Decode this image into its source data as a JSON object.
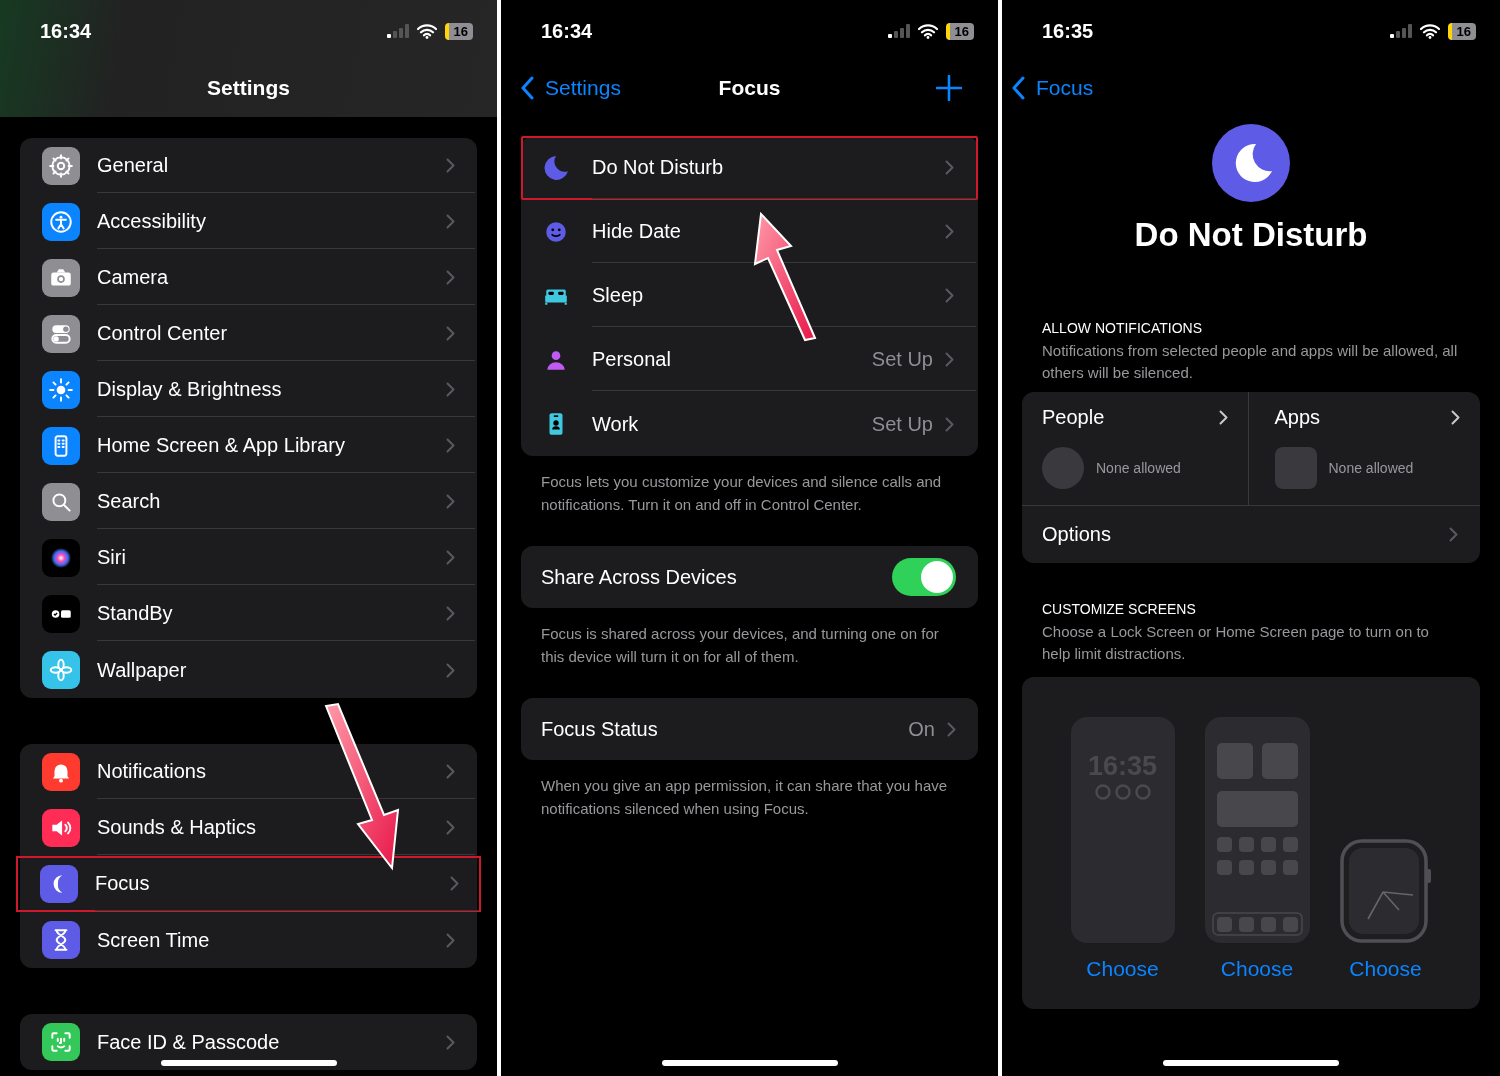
{
  "settings_screen": {
    "status_bar": {
      "time": "16:34",
      "battery": "16"
    },
    "title": "Settings",
    "groups": [
      {
        "items": [
          {
            "label": "General",
            "color": "#8e8e93",
            "highlighted": false
          },
          {
            "label": "Accessibility",
            "color": "#0a84ff",
            "highlighted": false
          },
          {
            "label": "Camera",
            "color": "#8e8e93",
            "highlighted": false
          },
          {
            "label": "Control Center",
            "color": "#8e8e93",
            "highlighted": false
          },
          {
            "label": "Display & Brightness",
            "color": "#0a84ff",
            "highlighted": false
          },
          {
            "label": "Home Screen & App Library",
            "color": "#0a84ff",
            "highlighted": false
          },
          {
            "label": "Search",
            "color": "#8e8e93",
            "highlighted": false
          },
          {
            "label": "Siri",
            "color": "#000000",
            "highlighted": false
          },
          {
            "label": "StandBy",
            "color": "#000000",
            "highlighted": false
          },
          {
            "label": "Wallpaper",
            "color": "#35c3ea",
            "highlighted": false
          }
        ]
      },
      {
        "items": [
          {
            "label": "Notifications",
            "color": "#ff3b30",
            "highlighted": false
          },
          {
            "label": "Sounds & Haptics",
            "color": "#ff2d55",
            "highlighted": false
          },
          {
            "label": "Focus",
            "color": "#5e5ce6",
            "highlighted": true
          },
          {
            "label": "Screen Time",
            "color": "#5e5ce6",
            "highlighted": false
          }
        ]
      },
      {
        "items": [
          {
            "label": "Face ID & Passcode",
            "color": "#34c759",
            "highlighted": false
          }
        ]
      }
    ]
  },
  "focus_screen": {
    "status_bar": {
      "time": "16:34",
      "battery": "16"
    },
    "back_label": "Settings",
    "title": "Focus",
    "modes": [
      {
        "label": "Do Not Disturb",
        "color": "#5e5ce6",
        "highlighted": true
      },
      {
        "label": "Hide Date",
        "color": "#5e5ce6",
        "highlighted": false
      },
      {
        "label": "Sleep",
        "color": "#40c8e0",
        "highlighted": false
      },
      {
        "label": "Personal",
        "value": "Set Up",
        "color": "#bf5af2",
        "highlighted": false
      },
      {
        "label": "Work",
        "value": "Set Up",
        "color": "#40c8e0",
        "highlighted": false
      }
    ],
    "modes_footer": "Focus lets you customize your devices and silence calls and notifications. Turn it on and off in Control Center.",
    "share": {
      "label": "Share Across Devices",
      "on": true
    },
    "share_footer": "Focus is shared across your devices, and turning one on for this device will turn it on for all of them.",
    "focus_status": {
      "label": "Focus Status",
      "value": "On"
    },
    "status_footer": "When you give an app permission, it can share that you have notifications silenced when using Focus."
  },
  "dnd_screen": {
    "status_bar": {
      "time": "16:35",
      "battery": "16"
    },
    "back_label": "Focus",
    "title": "Do Not Disturb",
    "allow": {
      "header": "ALLOW NOTIFICATIONS",
      "description": "Notifications from selected people and apps will be allowed, all others will be silenced.",
      "people": {
        "label": "People",
        "status": "None allowed"
      },
      "apps": {
        "label": "Apps",
        "status": "None allowed"
      },
      "options": "Options"
    },
    "customize": {
      "header": "CUSTOMIZE SCREENS",
      "description": "Choose a Lock Screen or Home Screen page to turn on to help limit distractions.",
      "lock_time": "16:35",
      "choices": [
        "Choose",
        "Choose",
        "Choose"
      ]
    }
  }
}
